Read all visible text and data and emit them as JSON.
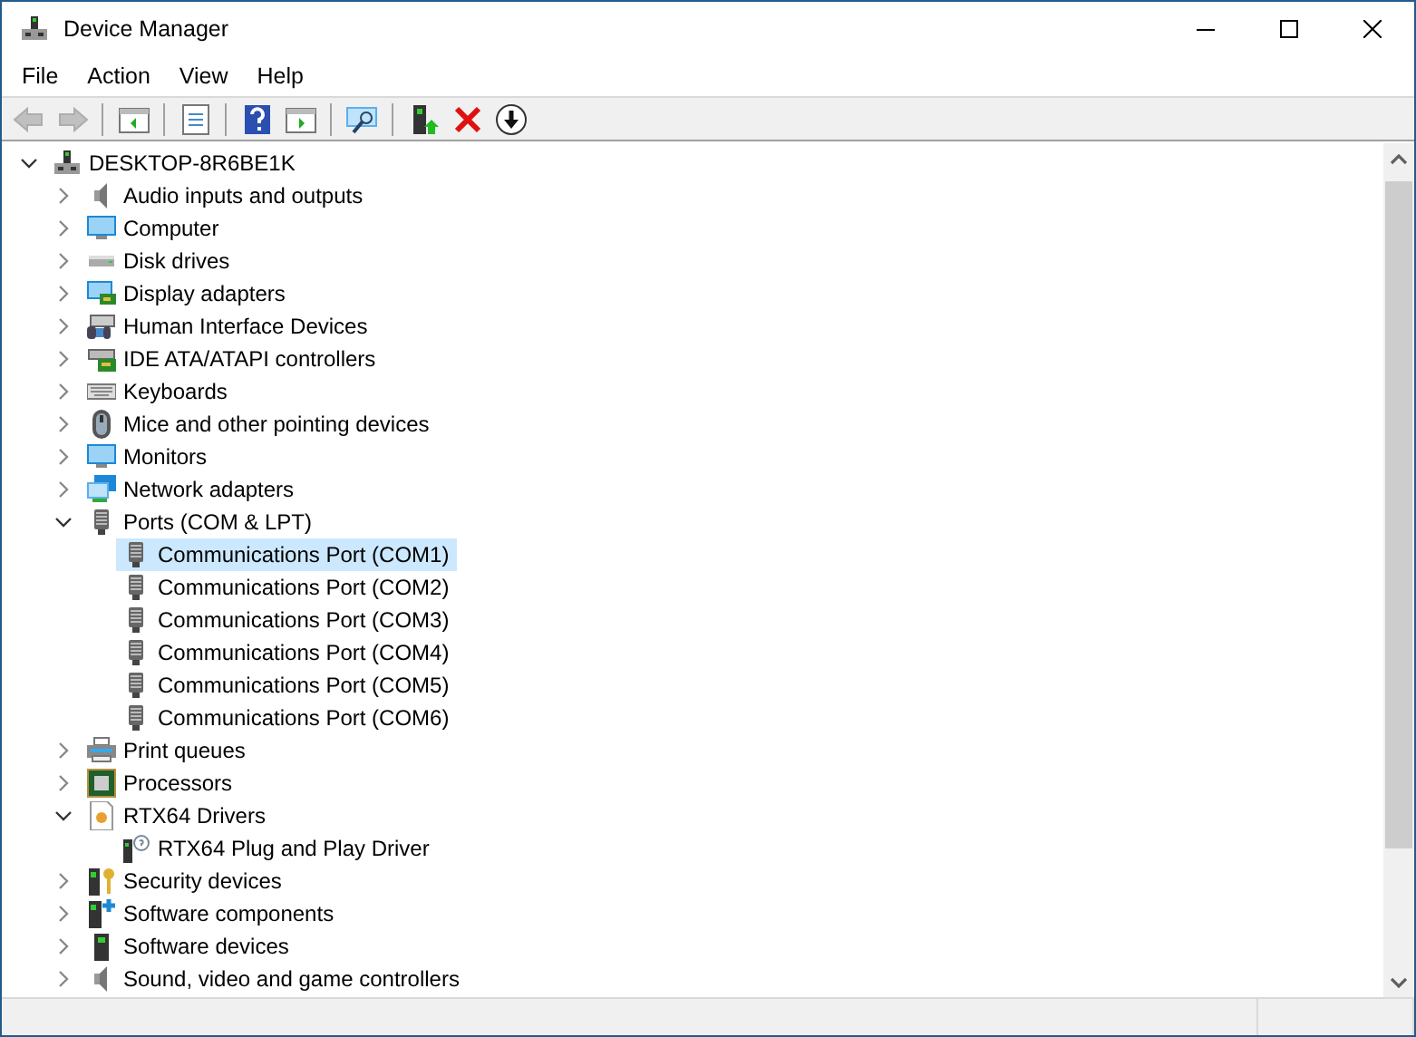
{
  "window": {
    "title": "Device Manager"
  },
  "menu": [
    {
      "label": "File"
    },
    {
      "label": "Action"
    },
    {
      "label": "View"
    },
    {
      "label": "Help"
    }
  ],
  "toolbar": [
    {
      "kind": "back",
      "disabled": true
    },
    {
      "kind": "forward",
      "disabled": true
    },
    {
      "kind": "sep"
    },
    {
      "kind": "tree"
    },
    {
      "kind": "sep"
    },
    {
      "kind": "props"
    },
    {
      "kind": "sep"
    },
    {
      "kind": "help"
    },
    {
      "kind": "pane"
    },
    {
      "kind": "sep"
    },
    {
      "kind": "scan"
    },
    {
      "kind": "sep"
    },
    {
      "kind": "update"
    },
    {
      "kind": "uninstall"
    },
    {
      "kind": "download"
    }
  ],
  "tree": {
    "label": "DESKTOP-8R6BE1K",
    "kind": "computer",
    "expanded": true,
    "selected": false,
    "children": [
      {
        "label": "Audio inputs and outputs",
        "kind": "speaker",
        "expanded": false,
        "selected": false
      },
      {
        "label": "Computer",
        "kind": "monitor",
        "expanded": false,
        "selected": false
      },
      {
        "label": "Disk drives",
        "kind": "disk",
        "expanded": false,
        "selected": false
      },
      {
        "label": "Display adapters",
        "kind": "display",
        "expanded": false,
        "selected": false
      },
      {
        "label": "Human Interface Devices",
        "kind": "hid",
        "expanded": false,
        "selected": false
      },
      {
        "label": "IDE ATA/ATAPI controllers",
        "kind": "ide",
        "expanded": false,
        "selected": false
      },
      {
        "label": "Keyboards",
        "kind": "keyboard",
        "expanded": false,
        "selected": false
      },
      {
        "label": "Mice and other pointing devices",
        "kind": "mouse",
        "expanded": false,
        "selected": false
      },
      {
        "label": "Monitors",
        "kind": "monitor",
        "expanded": false,
        "selected": false
      },
      {
        "label": "Network adapters",
        "kind": "network",
        "expanded": false,
        "selected": false
      },
      {
        "label": "Ports (COM & LPT)",
        "kind": "port",
        "expanded": true,
        "selected": false,
        "children": [
          {
            "label": "Communications Port (COM1)",
            "kind": "port",
            "selected": true
          },
          {
            "label": "Communications Port (COM2)",
            "kind": "port",
            "selected": false
          },
          {
            "label": "Communications Port (COM3)",
            "kind": "port",
            "selected": false
          },
          {
            "label": "Communications Port (COM4)",
            "kind": "port",
            "selected": false
          },
          {
            "label": "Communications Port (COM5)",
            "kind": "port",
            "selected": false
          },
          {
            "label": "Communications Port (COM6)",
            "kind": "port",
            "selected": false
          }
        ]
      },
      {
        "label": "Print queues",
        "kind": "printer",
        "expanded": false,
        "selected": false
      },
      {
        "label": "Processors",
        "kind": "cpu",
        "expanded": false,
        "selected": false
      },
      {
        "label": "RTX64 Drivers",
        "kind": "driver",
        "expanded": true,
        "selected": false,
        "children": [
          {
            "label": "RTX64 Plug and Play Driver",
            "kind": "unknown",
            "selected": false
          }
        ]
      },
      {
        "label": "Security devices",
        "kind": "security",
        "expanded": false,
        "selected": false
      },
      {
        "label": "Software components",
        "kind": "component",
        "expanded": false,
        "selected": false
      },
      {
        "label": "Software devices",
        "kind": "software",
        "expanded": false,
        "selected": false
      },
      {
        "label": "Sound, video and game controllers",
        "kind": "speaker",
        "expanded": false,
        "selected": false
      }
    ]
  }
}
